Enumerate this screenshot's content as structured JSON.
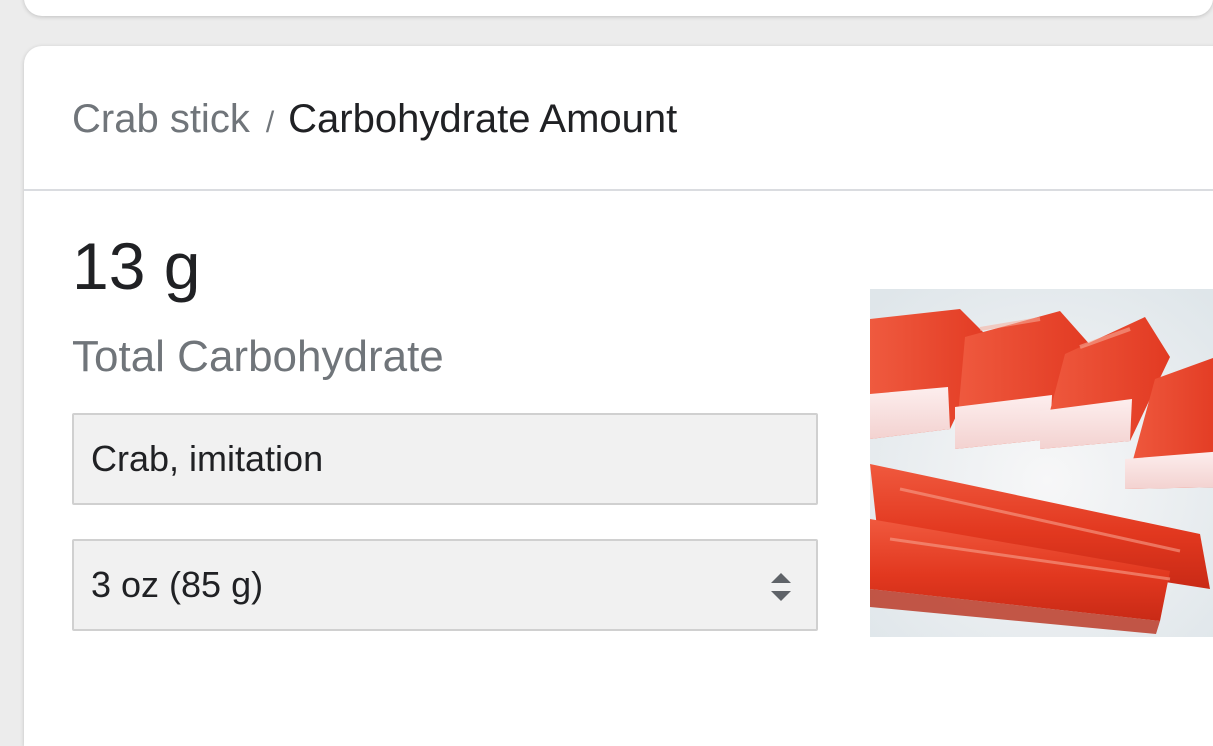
{
  "breadcrumb": {
    "food": "Crab stick",
    "separator": "/",
    "nutrient": "Carbohydrate Amount"
  },
  "result": {
    "amount": "13 g",
    "label": "Total Carbohydrate"
  },
  "food_select": {
    "value": "Crab, imitation"
  },
  "serving_select": {
    "value": "3 oz (85 g)"
  },
  "image": {
    "icon": "crab-stick-photo"
  },
  "colors": {
    "text_primary": "#202124",
    "text_secondary": "#70757a",
    "divider": "#dadce0",
    "field_bg": "#f1f1f1",
    "crab_red": "#e8412b"
  }
}
